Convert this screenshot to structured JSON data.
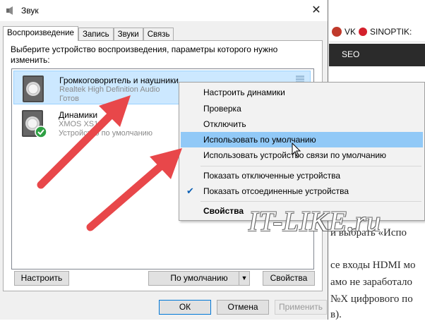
{
  "window": {
    "title": "Звук",
    "close_glyph": "✕"
  },
  "tabs": [
    {
      "label": "Воспроизведение",
      "active": true
    },
    {
      "label": "Запись"
    },
    {
      "label": "Звуки"
    },
    {
      "label": "Связь"
    }
  ],
  "instructions": "Выберите устройство воспроизведения, параметры которого нужно изменить:",
  "devices": [
    {
      "name": "Громкоговоритель и наушники",
      "driver": "Realtek High Definition Audio",
      "status": "Готов",
      "icon": "speaker-icon",
      "selected": true
    },
    {
      "name": "Динамики",
      "driver": "XMOS XS1-U",
      "status": "Устройство по умолчанию",
      "icon": "speaker-icon",
      "default_badge": "green-check-icon"
    }
  ],
  "panel_buttons": {
    "configure": "Настроить",
    "set_default": "По умолчанию",
    "properties": "Свойства"
  },
  "dialog_buttons": {
    "ok": "ОК",
    "cancel": "Отмена",
    "apply": "Применить"
  },
  "context_menu": [
    {
      "label": "Настроить динамики"
    },
    {
      "label": "Проверка"
    },
    {
      "label": "Отключить"
    },
    {
      "label": "Использовать по умолчанию",
      "highlighted": true
    },
    {
      "label": "Использовать устройство связи по умолчанию"
    },
    {
      "separator": true
    },
    {
      "label": "Показать отключенные устройства"
    },
    {
      "label": "Показать отсоединенные устройства",
      "checked": true
    },
    {
      "separator": true
    },
    {
      "label": "Свойства",
      "bold": true
    }
  ],
  "background_page": {
    "bookmarks": [
      "VK",
      "SINOPTIK:"
    ],
    "nav_item": "SEO",
    "text_lines": [
      "и выбрать «Испо",
      "се входы HDMI мо",
      "амо не заработало",
      "№X цифрового по",
      "в)."
    ]
  },
  "watermark": "IT-LIKE.ru",
  "colors": {
    "selection": "#cce8ff",
    "menu_highlight": "#91c9f7",
    "arrow": "#e8474a",
    "nav_bar": "#2b2b2b"
  }
}
